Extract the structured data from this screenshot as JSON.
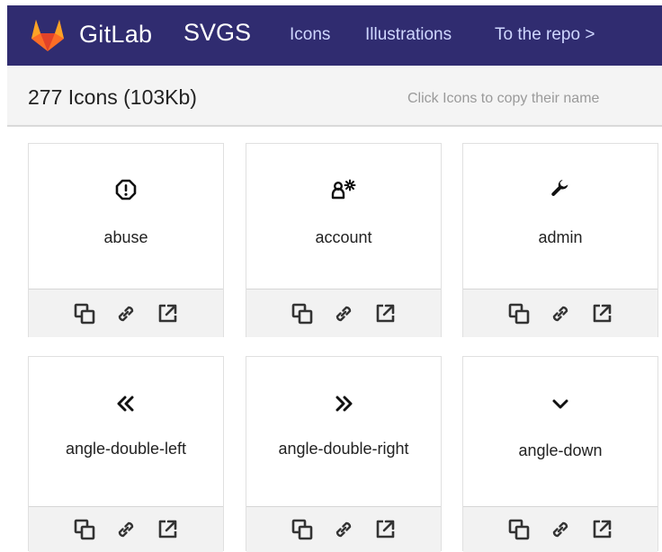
{
  "header": {
    "brand": "GitLab",
    "product": "SVGS",
    "nav": [
      "Icons",
      "Illustrations",
      "To the repo >"
    ]
  },
  "subheader": {
    "count_text": "277 Icons (103Kb)",
    "hint": "Click Icons to copy their name"
  },
  "icons": [
    {
      "name": "abuse",
      "icon": "octagon-exclamation-icon"
    },
    {
      "name": "account",
      "icon": "account-icon"
    },
    {
      "name": "admin",
      "icon": "wrench-icon"
    },
    {
      "name": "angle-double-left",
      "icon": "angle-double-left-icon"
    },
    {
      "name": "angle-double-right",
      "icon": "angle-double-right-icon"
    },
    {
      "name": "angle-down",
      "icon": "angle-down-icon"
    }
  ],
  "actions": [
    "copy-icon",
    "link-icon",
    "external-link-icon"
  ],
  "colors": {
    "header_bg": "#302c70",
    "nav_text": "#cfd7ff",
    "subbar_bg": "#f4f4f4",
    "logo_orange": "#fc6d26"
  }
}
